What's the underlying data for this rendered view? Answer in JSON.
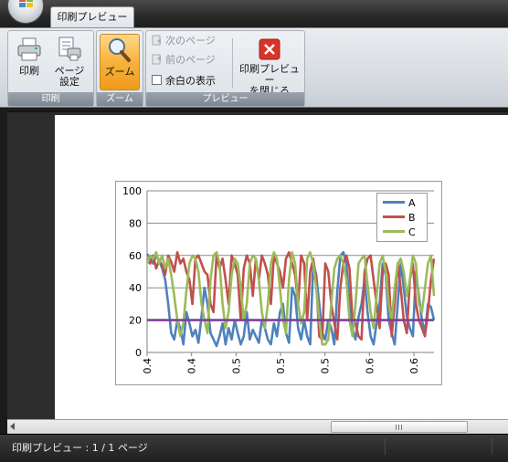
{
  "ribbon": {
    "tab_label": "印刷プレビュー",
    "groups": {
      "print": {
        "label": "印刷",
        "print_button": "印刷",
        "page_setup_line1": "ページ",
        "page_setup_line2": "設定"
      },
      "zoom": {
        "label": "ズーム",
        "zoom_button": "ズーム"
      },
      "preview": {
        "label": "プレビュー",
        "next_page": "次のページ",
        "prev_page": "前のページ",
        "show_margins": "余白の表示",
        "close_line1": "印刷プレビュー",
        "close_line2": "を閉じる"
      }
    }
  },
  "status": {
    "text": "印刷プレビュー : 1 / 1 ページ"
  },
  "colors": {
    "series_a": "#4f81bd",
    "series_b": "#c0504d",
    "series_c": "#9bbb59",
    "hline": "#7f3f98",
    "accent_zoom": "#f7b23b"
  },
  "chart_data": {
    "type": "line",
    "ylim": [
      0,
      100
    ],
    "yticks": [
      "0",
      "20",
      "40",
      "60",
      "80",
      "100"
    ],
    "xticks": [
      "0.4",
      "0.4",
      "0.5",
      "0.5",
      "0.5",
      "0.6",
      "0.6"
    ],
    "grid": true,
    "legend_position": "top-right",
    "reference_line": 20,
    "series": [
      {
        "name": "A",
        "values": [
          61,
          58,
          55,
          60,
          57,
          52,
          45,
          30,
          12,
          8,
          20,
          15,
          5,
          25,
          18,
          10,
          14,
          6,
          22,
          40,
          30,
          12,
          8,
          4,
          10,
          18,
          5,
          15,
          8,
          20,
          12,
          5,
          10,
          25,
          8,
          14,
          10,
          6,
          20,
          15,
          8,
          5,
          18,
          10,
          25,
          30,
          12,
          6,
          40,
          35,
          15,
          8,
          20,
          10,
          5,
          55,
          48,
          30,
          12,
          8,
          20,
          15,
          5,
          38,
          60,
          62,
          55,
          30,
          15,
          8,
          22,
          30,
          45,
          25,
          10,
          5,
          18,
          30,
          55,
          48,
          20,
          12,
          5,
          30,
          55,
          40,
          22,
          15,
          10,
          50,
          35,
          20,
          12,
          30,
          28,
          20
        ]
      },
      {
        "name": "B",
        "values": [
          58,
          55,
          60,
          52,
          57,
          54,
          48,
          60,
          56,
          50,
          62,
          55,
          58,
          50,
          45,
          30,
          58,
          60,
          55,
          50,
          48,
          30,
          25,
          60,
          52,
          58,
          45,
          30,
          60,
          55,
          48,
          20,
          52,
          60,
          55,
          35,
          58,
          45,
          60,
          55,
          48,
          30,
          60,
          55,
          50,
          40,
          58,
          62,
          55,
          48,
          30,
          60,
          55,
          20,
          50,
          58,
          45,
          10,
          8,
          55,
          50,
          30,
          18,
          8,
          40,
          55,
          60,
          52,
          20,
          18,
          10,
          8,
          50,
          58,
          60,
          45,
          30,
          15,
          50,
          55,
          48,
          10,
          30,
          55,
          40,
          20,
          12,
          45,
          55,
          30,
          20,
          15,
          10,
          25,
          45,
          58
        ]
      },
      {
        "name": "C",
        "values": [
          55,
          60,
          58,
          62,
          55,
          60,
          52,
          58,
          48,
          35,
          20,
          10,
          18,
          38,
          55,
          60,
          58,
          50,
          30,
          20,
          12,
          45,
          60,
          62,
          55,
          30,
          15,
          25,
          48,
          58,
          55,
          40,
          20,
          30,
          55,
          60,
          58,
          45,
          25,
          15,
          30,
          55,
          62,
          58,
          40,
          20,
          12,
          45,
          62,
          55,
          30,
          18,
          25,
          58,
          62,
          55,
          40,
          20,
          5,
          5,
          8,
          30,
          52,
          58,
          60,
          55,
          45,
          20,
          10,
          30,
          55,
          58,
          60,
          42,
          25,
          15,
          35,
          55,
          60,
          50,
          30,
          20,
          40,
          55,
          58,
          50,
          35,
          45,
          60,
          55,
          30,
          25,
          40,
          55,
          60,
          35
        ]
      }
    ]
  }
}
